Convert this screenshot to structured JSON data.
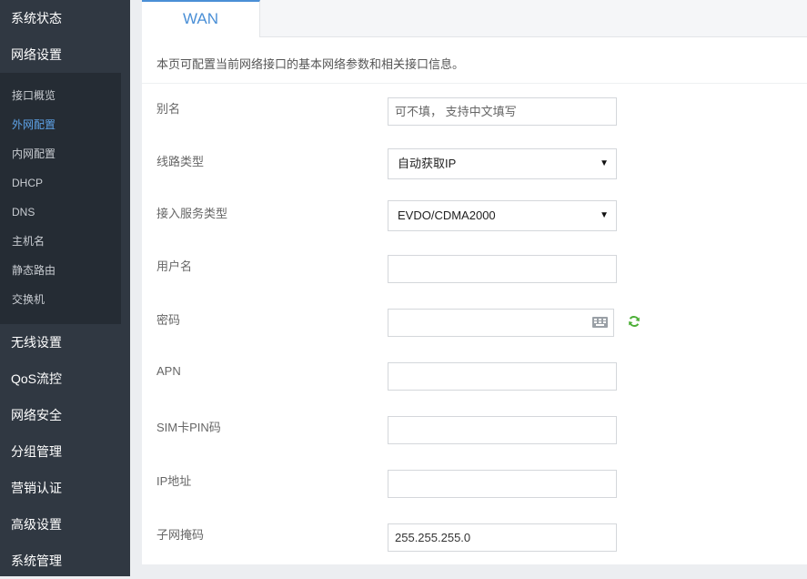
{
  "sidebar": {
    "items": [
      {
        "label": "系统状态"
      },
      {
        "label": "网络设置"
      },
      {
        "label": "无线设置"
      },
      {
        "label": "QoS流控"
      },
      {
        "label": "网络安全"
      },
      {
        "label": "分组管理"
      },
      {
        "label": "营销认证"
      },
      {
        "label": "高级设置"
      },
      {
        "label": "系统管理"
      }
    ],
    "submenu": [
      {
        "label": "接口概览"
      },
      {
        "label": "外网配置",
        "active": true
      },
      {
        "label": "内网配置"
      },
      {
        "label": "DHCP"
      },
      {
        "label": "DNS"
      },
      {
        "label": "主机名"
      },
      {
        "label": "静态路由"
      },
      {
        "label": "交换机"
      }
    ],
    "colors": {
      "background": "#303842",
      "submenu_bg": "#252c34",
      "active": "#5ea3e8"
    }
  },
  "tabs": [
    {
      "label": "WAN",
      "active": true
    }
  ],
  "description": "本页可配置当前网络接口的基本网络参数和相关接口信息。",
  "form": {
    "alias": {
      "label": "别名",
      "placeholder": "可不填， 支持中文填写",
      "value": ""
    },
    "line_type": {
      "label": "线路类型",
      "value": "自动获取IP"
    },
    "service_type": {
      "label": "接入服务类型",
      "value": "EVDO/CDMA2000"
    },
    "username": {
      "label": "用户名",
      "value": ""
    },
    "password": {
      "label": "密码",
      "value": ""
    },
    "apn": {
      "label": "APN",
      "value": ""
    },
    "sim_pin": {
      "label": "SIM卡PIN码",
      "value": ""
    },
    "ip": {
      "label": "IP地址",
      "value": ""
    },
    "netmask": {
      "label": "子网掩码",
      "value": "255.255.255.0"
    }
  },
  "icons": {
    "keyboard": "keyboard-icon",
    "refresh": "refresh-icon",
    "caret": "caret-down-icon"
  },
  "accent_color": "#4a8fd6"
}
